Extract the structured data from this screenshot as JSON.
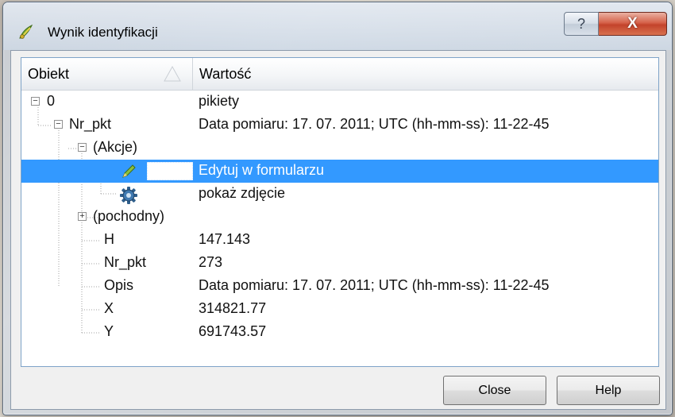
{
  "window": {
    "title": "Wynik identyfikacji",
    "help_glyph": "?",
    "close_glyph": "X"
  },
  "tree": {
    "headers": {
      "object": "Obiekt",
      "value": "Wartość"
    },
    "rows": [
      {
        "key": "0",
        "value": "pikiety"
      },
      {
        "key": "Nr_pkt",
        "value": "Data pomiaru: 17. 07. 2011; UTC (hh-mm-ss): 11-22-45"
      },
      {
        "key": "(Akcje)",
        "value": ""
      },
      {
        "key": "",
        "value": "Edytuj w formularzu"
      },
      {
        "key": "",
        "value": "pokaż zdjęcie"
      },
      {
        "key": "(pochodny)",
        "value": ""
      },
      {
        "key": "H",
        "value": "147.143"
      },
      {
        "key": "Nr_pkt",
        "value": "273"
      },
      {
        "key": "Opis",
        "value": "Data pomiaru: 17. 07. 2011; UTC (hh-mm-ss): 11-22-45"
      },
      {
        "key": "X",
        "value": "314821.77"
      },
      {
        "key": "Y",
        "value": "691743.57"
      }
    ],
    "selected_row": 3
  },
  "buttons": {
    "close": "Close",
    "help": "Help"
  },
  "icons": {
    "app": "qgis-icon",
    "sort": "sort-ascending-icon",
    "edit_action": "pencil-icon",
    "photo_action": "gear-icon"
  },
  "colors": {
    "selection": "#3399ff",
    "close_button": "#c3432b"
  }
}
